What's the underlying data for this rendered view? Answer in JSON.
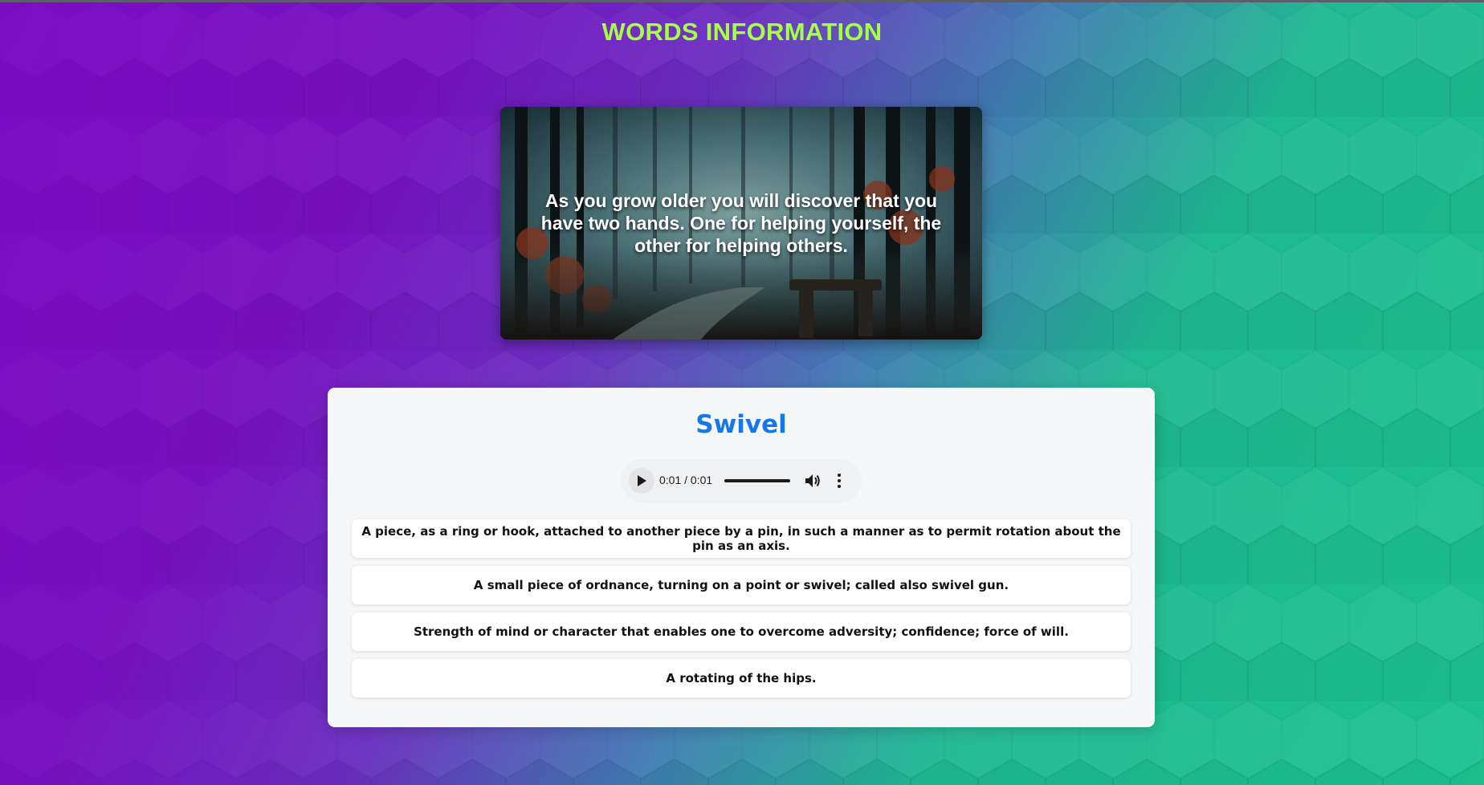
{
  "page": {
    "title": "WORDS INFORMATION",
    "title_color": "#a6ff47",
    "background_from": "#7a0cc4",
    "background_to": "#1cc290"
  },
  "hero": {
    "quote": "As you grow older you will discover that you have two hands. One for helping yourself, the other for helping others."
  },
  "word": {
    "term": "Swivel",
    "term_color": "#1677e8",
    "audio": {
      "time_display": "0:01 / 0:01",
      "progress": 1.0,
      "play_icon": "play-icon",
      "volume_icon": "volume-icon",
      "menu_icon": "more-vertical-icon"
    },
    "definitions": [
      "A piece, as a ring or hook, attached to another piece by a pin, in such a manner as to permit rotation about the pin as an axis.",
      "A small piece of ordnance, turning on a point or swivel; called also swivel gun.",
      "Strength of mind or character that enables one to overcome adversity; confidence; force of will.",
      "A rotating of the hips."
    ]
  }
}
